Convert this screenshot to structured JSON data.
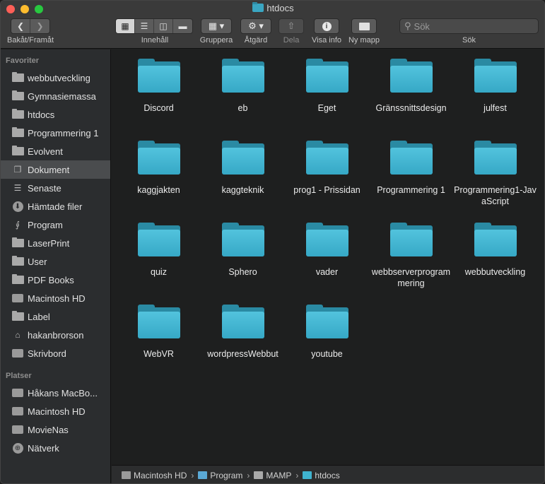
{
  "window": {
    "title": "htdocs"
  },
  "toolbar": {
    "nav_label": "Bakåt/Framåt",
    "view_label": "Innehåll",
    "group_label": "Gruppera",
    "action_label": "Åtgärd",
    "share_label": "Dela",
    "info_label": "Visa info",
    "newfolder_label": "Ny mapp",
    "search_label": "Sök",
    "search_placeholder": "Sök"
  },
  "sidebar": {
    "favorites_heading": "Favoriter",
    "favorites": [
      {
        "label": "webbutveckling",
        "icon": "folder-icon"
      },
      {
        "label": "Gymnasiemassa",
        "icon": "folder-icon"
      },
      {
        "label": "htdocs",
        "icon": "folder-icon"
      },
      {
        "label": "Programmering 1",
        "icon": "folder-icon"
      },
      {
        "label": "Evolvent",
        "icon": "folder-icon"
      },
      {
        "label": "Dokument",
        "icon": "document-icon",
        "selected": true
      },
      {
        "label": "Senaste",
        "icon": "recents-icon"
      },
      {
        "label": "Hämtade filer",
        "icon": "download-icon"
      },
      {
        "label": "Program",
        "icon": "applications-icon"
      },
      {
        "label": "LaserPrint",
        "icon": "folder-icon"
      },
      {
        "label": "User",
        "icon": "folder-icon"
      },
      {
        "label": "PDF Books",
        "icon": "folder-icon"
      },
      {
        "label": "Macintosh HD",
        "icon": "disk-icon"
      },
      {
        "label": "Label",
        "icon": "folder-icon"
      },
      {
        "label": "hakanbrorson",
        "icon": "home-icon"
      },
      {
        "label": "Skrivbord",
        "icon": "desktop-icon"
      }
    ],
    "places_heading": "Platser",
    "places": [
      {
        "label": "Håkans MacBo...",
        "icon": "laptop-icon"
      },
      {
        "label": "Macintosh HD",
        "icon": "disk-icon"
      },
      {
        "label": "MovieNas",
        "icon": "server-icon"
      },
      {
        "label": "Nätverk",
        "icon": "network-icon"
      }
    ]
  },
  "folders": [
    "Discord",
    "eb",
    "Eget",
    "Gränssnittsdesign",
    "julfest",
    "kaggjakten",
    "kaggteknik",
    "prog1 - Prissidan",
    "Programmering 1",
    "Programmering1-JavaScript",
    "quiz",
    "Sphero",
    "vader",
    "webbserverprogrammering",
    "webbutveckling",
    "WebVR",
    "wordpressWebbut",
    "youtube"
  ],
  "pathbar": [
    {
      "label": "Macintosh HD",
      "icon": "disk-icon"
    },
    {
      "label": "Program",
      "icon": "applications-folder-icon"
    },
    {
      "label": "MAMP",
      "icon": "folder-icon"
    },
    {
      "label": "htdocs",
      "icon": "folder-icon"
    }
  ],
  "colors": {
    "folder": "#3fb3cf",
    "selection": "#4a4c4e"
  }
}
